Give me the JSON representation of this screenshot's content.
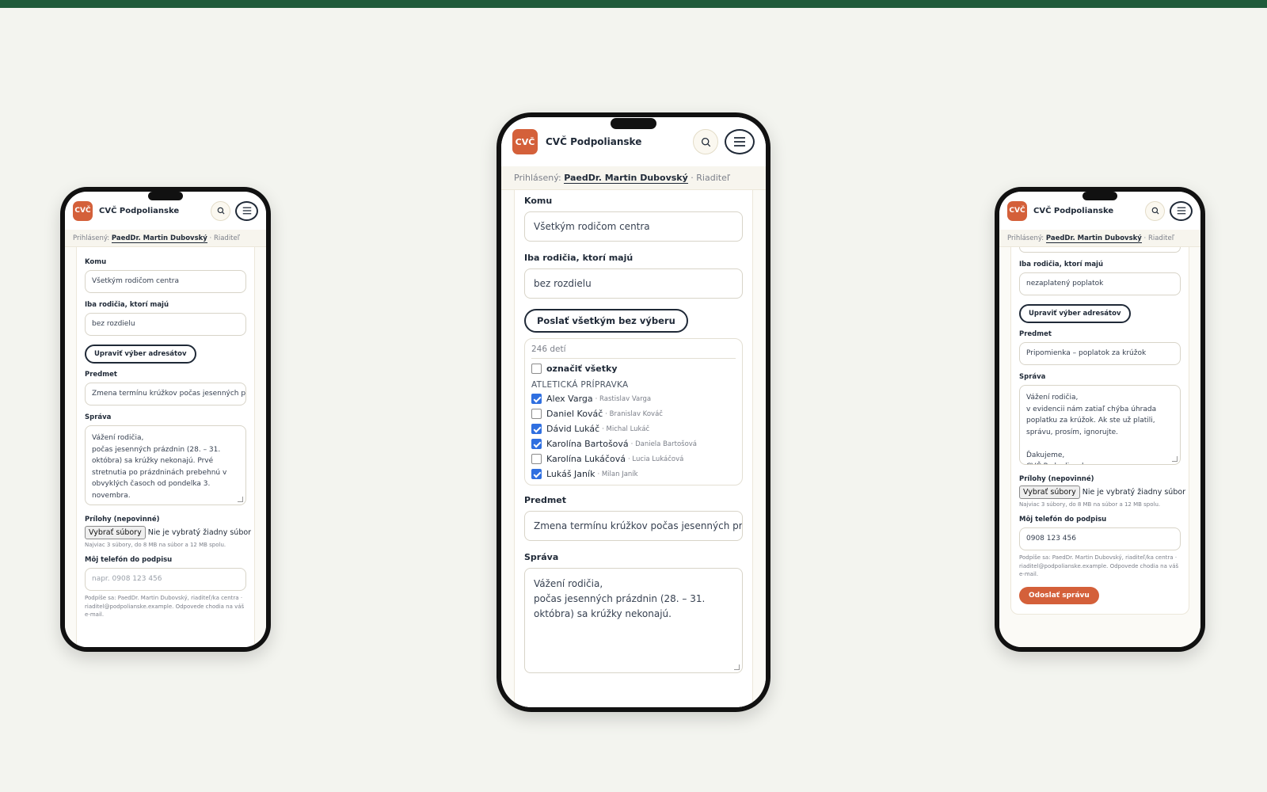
{
  "app": {
    "logo_text": "CVČ",
    "name": "CVČ Podpolianske",
    "search_icon": "search-icon",
    "menu_icon": "hamburger-icon",
    "accent_color": "#d4603a",
    "topbar_color": "#1f5a3a"
  },
  "login": {
    "prefix": "Prihlásený:",
    "user": "PaedDr. Martin Dubovský",
    "role": "· Riaditeľ"
  },
  "left_phone": {
    "komu_label": "Komu",
    "komu_value": "Všetkým rodičom centra",
    "filter_label": "Iba rodičia, ktorí majú",
    "filter_value": "bez rozdielu",
    "edit_button": "Upraviť výber adresátov",
    "subject_label": "Predmet",
    "subject_value": "Zmena termínu krúžkov počas jesenných práz",
    "message_label": "Správa",
    "message_value": "Vážení rodičia,\npočas jesenných prázdnin (28. – 31. októbra) sa krúžky nekonajú. Prvé stretnutia po prázdninách prebehnú v obvyklých časoch od pondelka 3. novembra.\n\nĎakujeme za pochopenie",
    "attach_label": "Prílohy (nepovinné)",
    "file_button": "Vybrať súbory",
    "file_status": "Nie je vybratý žiadny súbor",
    "attach_hint": "Najviac 3 súbory, do 8 MB na súbor a 12 MB spolu.",
    "phone_label": "Môj telefón do podpisu",
    "phone_placeholder": "napr. 0908 123 456",
    "signature_hint": "Podpíše sa: PaedDr. Martin Dubovský, riaditeľ/ka centra · riaditel@podpolianske.example. Odpovede chodia na váš e-mail."
  },
  "center_phone": {
    "komu_label": "Komu",
    "komu_value": "Všetkým rodičom centra",
    "filter_label": "Iba rodičia, ktorí majú",
    "filter_value": "bez rozdielu",
    "send_all_button": "Poslať všetkým bez výberu",
    "count_text": "246 detí",
    "select_all": "označiť všetky",
    "group_name": "ATLETICKÁ PRÍPRAVKA",
    "children": [
      {
        "name": "Alex Varga",
        "parent": "· Rastislav Varga",
        "checked": true
      },
      {
        "name": "Daniel Kováč",
        "parent": "· Branislav Kováč",
        "checked": false
      },
      {
        "name": "Dávid Lukáč",
        "parent": "· Michal Lukáč",
        "checked": true
      },
      {
        "name": "Karolína Bartošová",
        "parent": "· Daniela Bartošová",
        "checked": true
      },
      {
        "name": "Karolína Lukáčová",
        "parent": "· Lucia Lukáčová",
        "checked": false
      },
      {
        "name": "Lukáš Janík",
        "parent": "· Milan Janík",
        "checked": true
      }
    ],
    "subject_label": "Predmet",
    "subject_value": "Zmena termínu krúžkov počas jesenných práz",
    "message_label": "Správa",
    "message_value": "Vážení rodičia,\npočas jesenných prázdnin (28. – 31. októbra) sa krúžky nekonajú."
  },
  "right_phone": {
    "filter_label": "Iba rodičia, ktorí majú",
    "filter_value": "nezaplatený poplatok",
    "edit_button": "Upraviť výber adresátov",
    "subject_label": "Predmet",
    "subject_value": "Pripomienka – poplatok za krúžok",
    "message_label": "Správa",
    "message_value": "Vážení rodičia,\nv evidencii nám zatiaľ chýba úhrada poplatku za krúžok. Ak ste už platili, správu, prosím, ignorujte.\n\nĎakujeme,\nCVČ Podpolianske",
    "attach_label": "Prílohy (nepovinné)",
    "file_button": "Vybrať súbory",
    "file_status": "Nie je vybratý žiadny súbor",
    "attach_hint": "Najviac 3 súbory, do 8 MB na súbor a 12 MB spolu.",
    "phone_label": "Môj telefón do podpisu",
    "phone_value": "0908 123 456",
    "signature_hint": "Podpíše sa: PaedDr. Martin Dubovský, riaditeľ/ka centra · riaditel@podpolianske.example. Odpovede chodia na váš e-mail.",
    "submit_button": "Odoslať správu"
  }
}
